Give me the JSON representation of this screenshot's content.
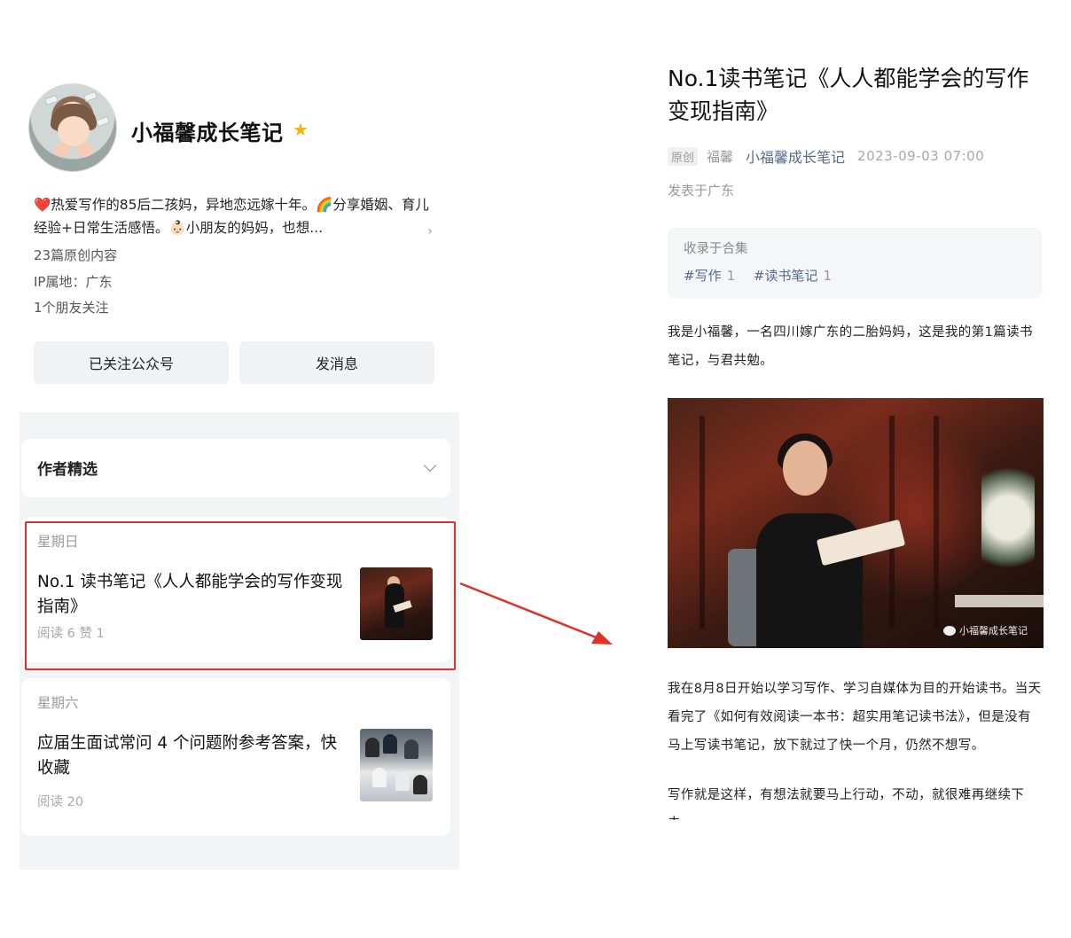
{
  "profile": {
    "name": "小福馨成长笔记",
    "star": "★",
    "bio": "❤️热爱写作的85后二孩妈，异地恋远嫁十年。🌈分享婚姻、育儿经验+日常生活感悟。👶🏻小朋友的妈妈，也想...",
    "bio_more": "›",
    "originals": "23篇原创内容",
    "ip": "IP属地：广东",
    "friends": "1个朋友关注",
    "follow_button": "已关注公众号",
    "message_button": "发消息"
  },
  "feed": {
    "selector_label": "作者精选",
    "posts": [
      {
        "day": "星期日",
        "title": "No.1 读书笔记《人人都能学会的写作变现指南》",
        "stats": "阅读 6   赞 1"
      },
      {
        "day": "星期六",
        "title": "应届生面试常问 4 个问题附参考答案，快收藏",
        "stats": "阅读 20"
      }
    ]
  },
  "article": {
    "title": "No.1读书笔记《人人都能学会的写作变现指南》",
    "original_tag": "原创",
    "editor": "福馨",
    "account": "小福馨成长笔记",
    "time": "2023-09-03 07:00",
    "location": "发表于广东",
    "collection_label": "收录于合集",
    "collection_tags": [
      {
        "name": "#写作",
        "count": "1"
      },
      {
        "name": "#读书笔记",
        "count": "1"
      }
    ],
    "para1": "我是小福馨，一名四川嫁广东的二胎妈妈，这是我的第1篇读书笔记，与君共勉。",
    "watermark": "小福馨成长笔记",
    "para2": "我在8月8日开始以学习写作、学习自媒体为目的开始读书。当天看完了《如何有效阅读一本书：超实用笔记读书法》，但是没有马上写读书笔记，放下就过了快一个月，仍然不想写。",
    "para3": "写作就是这样，有想法就要马上行动，不动，就很难再继续下去。"
  },
  "colors": {
    "highlight": "#e0302a",
    "link": "#536a8e",
    "star": "#f5b400"
  }
}
